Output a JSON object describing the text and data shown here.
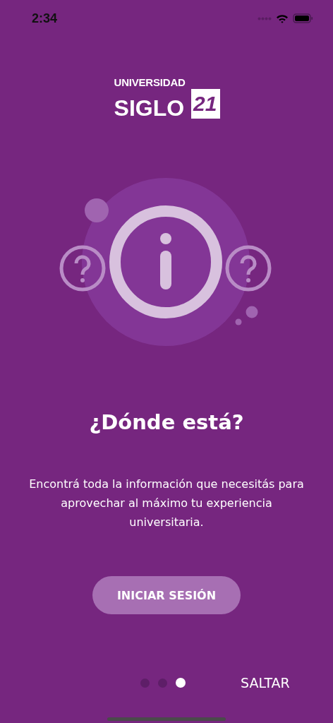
{
  "status_bar": {
    "time": "2:34"
  },
  "logo": {
    "line_1": "UNIVERSIDAD",
    "line_2": "SIGLO",
    "badge": "21"
  },
  "title": "¿Dónde está?",
  "description": "Encontrá toda la información que necesitás para aprovechar al máximo tu experiencia universitaria.",
  "login_button": "INICIAR SESIÓN",
  "pager": [
    {
      "selected": false
    },
    {
      "selected": false
    },
    {
      "selected": true
    }
  ],
  "skip_button": "SALTAR"
}
